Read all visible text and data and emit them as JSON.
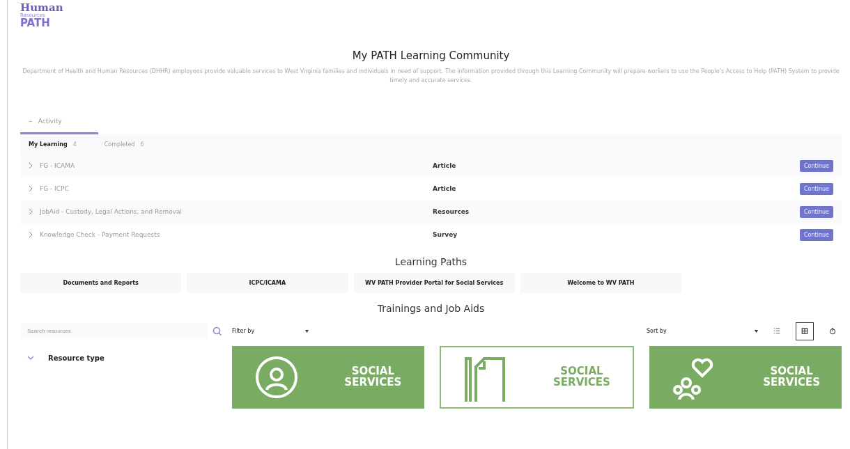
{
  "logo": {
    "line_1": "Human",
    "line_2": "Resources",
    "line_3": "PATH"
  },
  "title": "My PATH Learning Community",
  "description": "Department of Health and Human Resources (DHHR) employees provide valuable services to West Virginia families and individuals in need of support. The information provided through this Learning Community will prepare workers to use the People's Access to Help (PATH) System to provide timely and accurate services.",
  "activity": {
    "toggle": "−",
    "label": "Activity",
    "expanded": true,
    "tabs": [
      {
        "label": "My Learning",
        "count": "4",
        "selected": true
      },
      {
        "label": "Completed",
        "count": "6",
        "selected": false
      }
    ],
    "rows": [
      {
        "name": "FG - ICAMA",
        "type": "Article",
        "button": "Continue"
      },
      {
        "name": "FG - ICPC",
        "type": "Article",
        "button": "Continue"
      },
      {
        "name": "JobAid - Custody, Legal Actions, and Removal",
        "type": "Resources",
        "button": "Continue"
      },
      {
        "name": "Knowledge Check - Payment Requests",
        "type": "Survey",
        "button": "Continue"
      }
    ]
  },
  "learning_paths": {
    "title": "Learning Paths",
    "items": [
      "Documents and Reports",
      "ICPC/ICAMA",
      "WV PATH Provider Portal for Social Services",
      "Welcome to WV PATH"
    ]
  },
  "trainings": {
    "title": "Trainings and Job Aids",
    "search": {
      "placeholder": "Search resources"
    },
    "filter": "Filter by",
    "sort": "Sort by",
    "views": [
      {
        "kind": "list",
        "selected": false
      },
      {
        "kind": "grid",
        "selected": true
      },
      {
        "kind": "timer",
        "selected": false
      }
    ],
    "facet": {
      "label": "Resource type",
      "expanded": true
    },
    "cards": [
      {
        "kind": "person",
        "label_1": "SOCIAL",
        "label_2": "SERVICES"
      },
      {
        "kind": "document",
        "label_1": "SOCIAL",
        "label_2": "SERVICES"
      },
      {
        "kind": "group",
        "label_1": "SOCIAL",
        "label_2": "SERVICES"
      }
    ]
  }
}
